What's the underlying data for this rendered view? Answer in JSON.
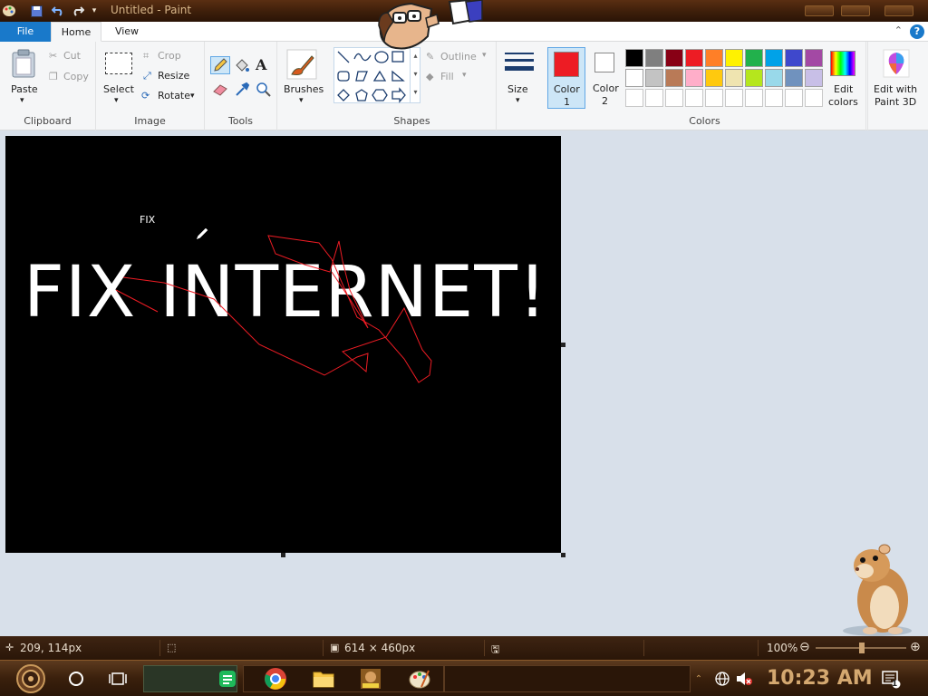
{
  "window": {
    "title": "Untitled - Paint"
  },
  "tabs": [
    {
      "label": "File"
    },
    {
      "label": "Home"
    },
    {
      "label": "View"
    }
  ],
  "help_label": "?",
  "ribbon": {
    "clipboard": {
      "group_label": "Clipboard",
      "paste": "Paste",
      "cut": "Cut",
      "copy": "Copy"
    },
    "image": {
      "group_label": "Image",
      "select": "Select",
      "crop": "Crop",
      "resize": "Resize",
      "rotate": "Rotate"
    },
    "tools": {
      "group_label": "Tools",
      "text_tool": "A"
    },
    "brushes": {
      "label": "Brushes"
    },
    "shapes": {
      "group_label": "Shapes",
      "outline": "Outline",
      "fill": "Fill"
    },
    "size": {
      "label": "Size"
    },
    "colors": {
      "group_label": "Colors",
      "color1_label": "Color",
      "color1_num": "1",
      "color2_label": "Color",
      "color2_num": "2",
      "color1": "#ed1c24",
      "color2": "#ffffff",
      "edit_colors_1": "Edit",
      "edit_colors_2": "colors",
      "paint3d_1": "Edit with",
      "paint3d_2": "Paint 3D",
      "palette": [
        "#000000",
        "#7f7f7f",
        "#880015",
        "#ed1c24",
        "#ff7f27",
        "#fff200",
        "#22b14c",
        "#00a2e8",
        "#3f48cc",
        "#a349a4",
        "#ffffff",
        "#c3c3c3",
        "#b97a57",
        "#ffaec9",
        "#ffc90e",
        "#efe4b0",
        "#b5e61d",
        "#99d9ea",
        "#7092be",
        "#c8bfe7"
      ]
    }
  },
  "canvas": {
    "small_text": "FIX",
    "big_text": "FIX INTERNET!"
  },
  "status": {
    "cursor_pos": "209, 114px",
    "image_size": "614 × 460px",
    "zoom": "100%"
  },
  "taskbar": {
    "clock": "10:23 AM",
    "notification_count": "1"
  }
}
